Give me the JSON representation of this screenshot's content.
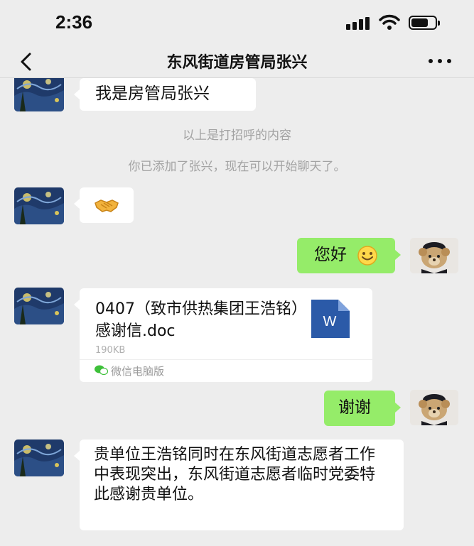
{
  "status_bar": {
    "time": "2:36"
  },
  "nav": {
    "title": "东风街道房管局张兴"
  },
  "messages": {
    "m1": "我是房管局张兴",
    "sys1": "以上是打招呼的内容",
    "sys2": "你已添加了张兴，现在可以开始聊天了。",
    "m2_emoji": "handshake-emoji",
    "m3": "您好",
    "m3_emoji": "smile-emoji",
    "file": {
      "name": "0407（致市供热集团王浩铭）感谢信.doc",
      "size": "190KB",
      "source": "微信电脑版",
      "icon_letter": "W"
    },
    "m4": "谢谢",
    "m5": "贵单位王浩铭同时在东风街道志愿者工作中表现突出，东风街道志愿者临时党委特此感谢贵单位。"
  },
  "colors": {
    "background": "#ededed",
    "outgoing_bubble": "#95ec69",
    "incoming_bubble": "#ffffff",
    "word_icon": "#2b5aa8"
  }
}
